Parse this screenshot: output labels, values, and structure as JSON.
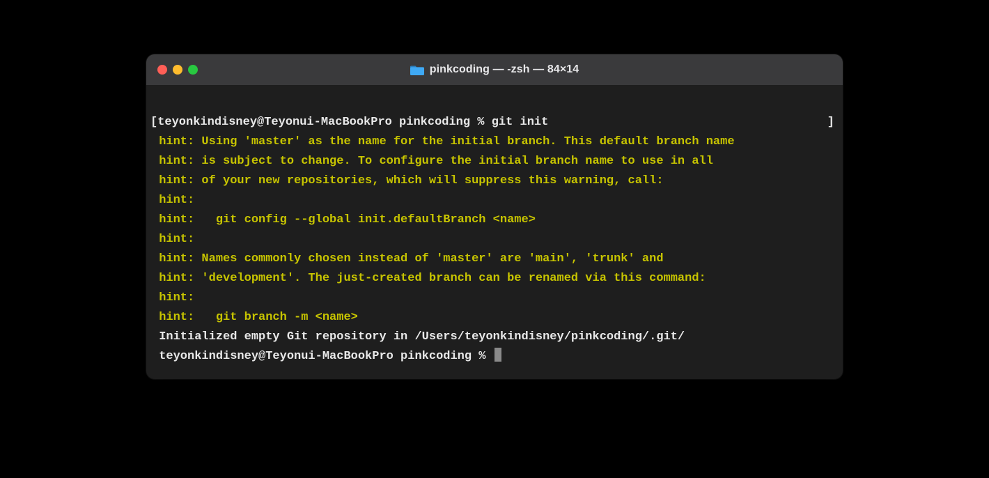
{
  "window": {
    "title": "pinkcoding — -zsh — 84×14"
  },
  "terminal": {
    "prompt1_left": "[teyonkindisney@Teyonui-MacBookPro pinkcoding % ",
    "prompt1_cmd": "git init",
    "prompt1_right": "]",
    "hints": [
      " hint: Using 'master' as the name for the initial branch. This default branch name",
      " hint: is subject to change. To configure the initial branch name to use in all",
      " hint: of your new repositories, which will suppress this warning, call:",
      " hint:",
      " hint:   git config --global init.defaultBranch <name>",
      " hint:",
      " hint: Names commonly chosen instead of 'master' are 'main', 'trunk' and",
      " hint: 'development'. The just-created branch can be renamed via this command:",
      " hint:",
      " hint:   git branch -m <name>"
    ],
    "init_msg": " Initialized empty Git repository in /Users/teyonkindisney/pinkcoding/.git/",
    "prompt2": " teyonkindisney@Teyonui-MacBookPro pinkcoding % "
  }
}
